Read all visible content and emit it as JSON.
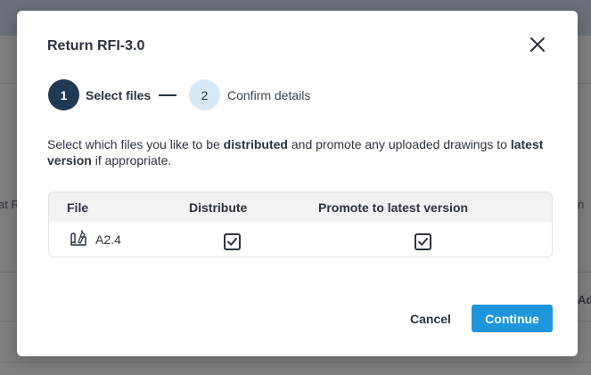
{
  "background": {
    "left_fragment": "at R",
    "right_fragment_1": "n",
    "right_fragment_2": "Ad"
  },
  "modal": {
    "title": "Return RFI-3.0",
    "close_icon": "close-icon",
    "stepper": {
      "steps": [
        {
          "number": "1",
          "label": "Select files",
          "active": true
        },
        {
          "number": "2",
          "label": "Confirm details",
          "active": false
        }
      ]
    },
    "description": {
      "part1": "Select which files you like to be ",
      "bold1": "distributed",
      "part2": " and promote any uploaded drawings to ",
      "bold2": "latest version",
      "part3": " if appropriate."
    },
    "table": {
      "headers": {
        "file": "File",
        "distribute": "Distribute",
        "promote": "Promote to latest version"
      },
      "rows": [
        {
          "icon": "drawing-file-icon",
          "file": "A2.4",
          "distribute": true,
          "promote": true
        }
      ]
    },
    "buttons": {
      "cancel": "Cancel",
      "continue": "Continue"
    },
    "colors": {
      "accent": "#1e96dc",
      "step_active": "#1f3a52",
      "step_inactive": "#d7e9f6",
      "text": "#2c3340"
    }
  }
}
